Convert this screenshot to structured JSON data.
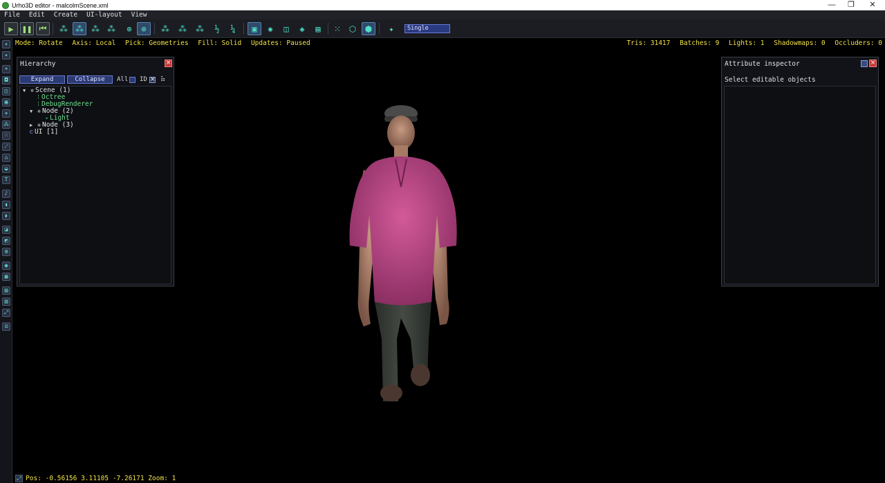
{
  "window": {
    "title": "Urho3D editor - malcolmScene.xml",
    "minimize": "—",
    "restore": "❐",
    "close": "✕"
  },
  "menu": [
    "File",
    "Edit",
    "Create",
    "UI-layout",
    "View"
  ],
  "toolbar": {
    "pick_mode": "Single"
  },
  "status": {
    "mode": "Mode: Rotate",
    "axis": "Axis: Local",
    "pick": "Pick: Geometries",
    "fill": "Fill: Solid",
    "updates": "Updates: Paused",
    "tris": "Tris: 31417",
    "batches": "Batches: 9",
    "lights": "Lights: 1",
    "shadowmaps": "Shadowmaps: 0",
    "occluders": "Occluders: 0"
  },
  "hierarchy": {
    "title": "Hierarchy",
    "expand": "Expand",
    "collapse": "Collapse",
    "all_label": "All",
    "id_label": "ID",
    "items": [
      {
        "label": "Scene (1)",
        "kind": "node",
        "arrow": "▼"
      },
      {
        "label": "Octree",
        "kind": "component"
      },
      {
        "label": "DebugRenderer",
        "kind": "component"
      },
      {
        "label": "Node (2)",
        "kind": "node",
        "arrow": "▼"
      },
      {
        "label": "Light",
        "kind": "component"
      },
      {
        "label": "Node (3)",
        "kind": "node",
        "arrow": "▶"
      },
      {
        "label": "UI [1]",
        "kind": "ui"
      }
    ]
  },
  "inspector": {
    "title": "Attribute inspector",
    "message": "Select editable objects"
  },
  "camera": {
    "pos": "Pos: -0.56156 3.11105  -7.26171 Zoom: 1"
  },
  "colors": {
    "status_text": "#f2e24a",
    "accent_blue": "#2a3a74",
    "component_green": "#6ee08c",
    "close_red": "#c63a3a"
  }
}
